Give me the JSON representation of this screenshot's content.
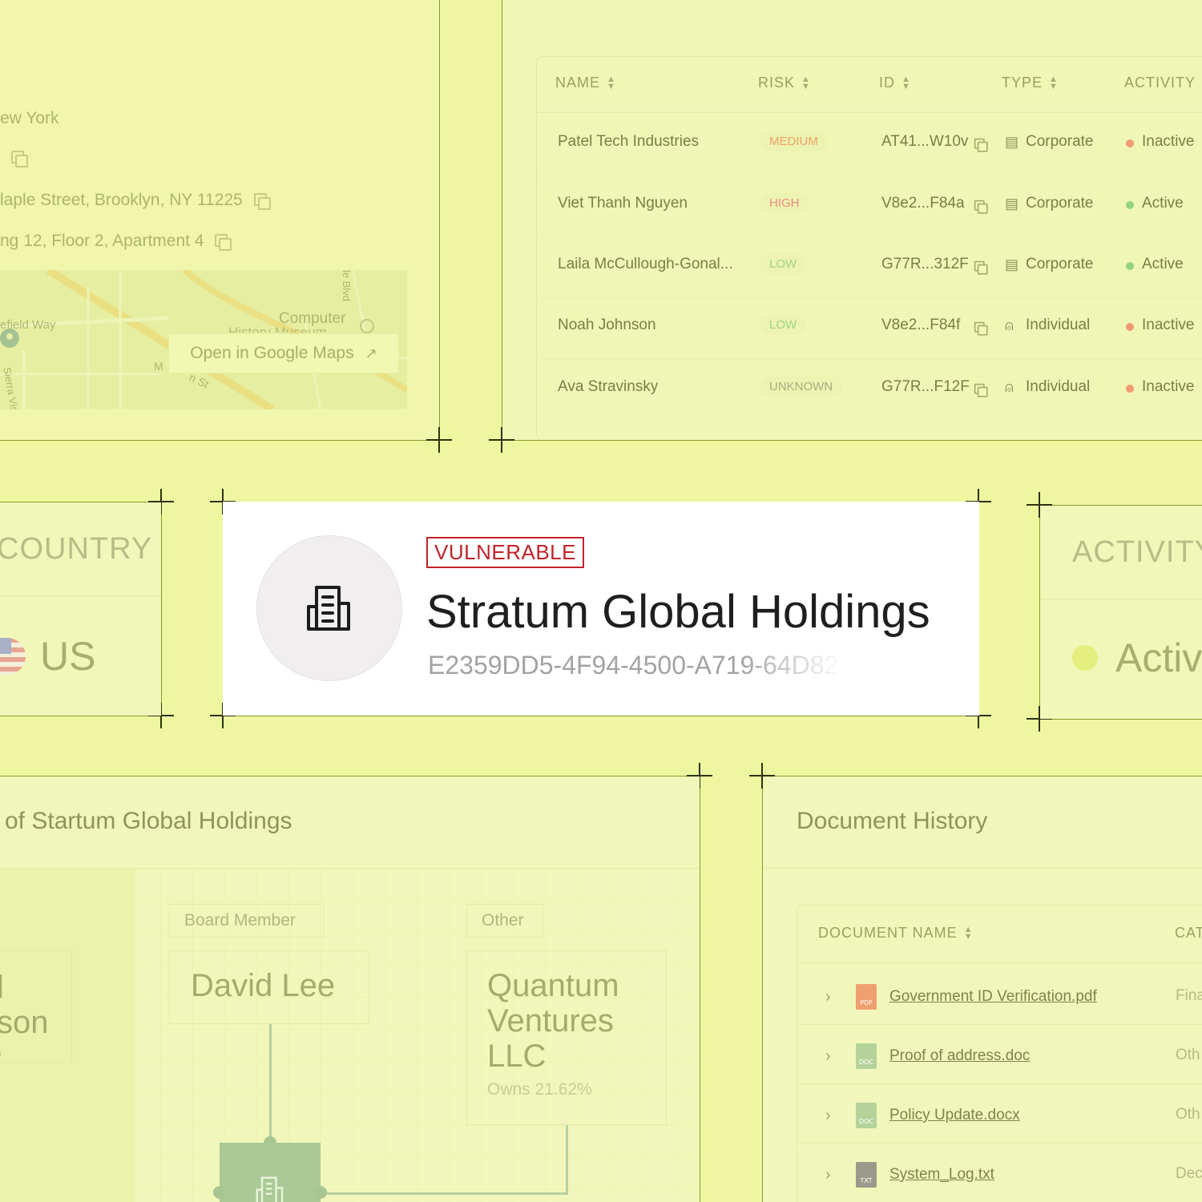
{
  "address": {
    "lines": [
      "ew York",
      "",
      "laple Street, Brooklyn, NY 11225",
      "ng 12, Floor 2, Apartment 4"
    ],
    "map_labels": [
      "Computer",
      "History Museum",
      "efield Way",
      "Sierra Vista Av",
      "le Blvd",
      "M",
      "n St"
    ],
    "map_button": "Open in Google Maps"
  },
  "table": {
    "headers": [
      "NAME",
      "RISK",
      "ID",
      "TYPE",
      "ACTIVITY"
    ],
    "rows": [
      {
        "name": "Patel Tech Industries",
        "risk": "MEDIUM",
        "id": "AT41...W10v",
        "type": "Corporate",
        "activity": "Inactive"
      },
      {
        "name": "Viet Thanh Nguyen",
        "risk": "HIGH",
        "id": "V8e2...F84a",
        "type": "Corporate",
        "activity": "Active"
      },
      {
        "name": "Laila McCullough-Gonal...",
        "risk": "LOW",
        "id": "G77R...312F",
        "type": "Corporate",
        "activity": "Active"
      },
      {
        "name": "Noah Johnson",
        "risk": "LOW",
        "id": "V8e2...F84f",
        "type": "Individual",
        "activity": "Inactive"
      },
      {
        "name": "Ava Stravinsky",
        "risk": "UNKNOWN",
        "id": "G77R...F12F",
        "type": "Individual",
        "activity": "Inactive"
      }
    ]
  },
  "colors": {
    "risk": {
      "MEDIUM": "#f0a06a",
      "HIGH": "#ec8a86",
      "LOW": "#9fd48a",
      "UNKNOWN": "#a8ac82"
    },
    "activity": {
      "Active": "#93d47c",
      "Inactive": "#f09a72"
    },
    "vulnerable": "#c0242a",
    "background": "#eef7a0"
  },
  "hero": {
    "badge": "VULNERABLE",
    "title": "Stratum Global Holdings",
    "id": "E2359DD5-4F94-4500-A719-64D82",
    "icon": "building-icon"
  },
  "country": {
    "label": "COUNTRY",
    "value": "US",
    "flag": "us-flag-icon"
  },
  "activity": {
    "label": "ACTIVITY",
    "value": "Activ"
  },
  "ownership": {
    "title": "of Startum Global Holdings",
    "partial": {
      "name_lines": [
        "l",
        "son"
      ],
      "sub": "o"
    },
    "board": {
      "role": "Board Member",
      "name": "David Lee"
    },
    "other": {
      "role": "Other",
      "name_lines": [
        "Quantum",
        "Ventures",
        "LLC"
      ],
      "sub": "Owns 21.62%"
    }
  },
  "documents": {
    "title": "Document History",
    "headers": [
      "DOCUMENT NAME",
      "CAT"
    ],
    "rows": [
      {
        "name": "Government ID Verification.pdf",
        "ext": "PDF",
        "category": "Fina"
      },
      {
        "name": "Proof of address.doc",
        "ext": "DOC",
        "category": "Oth"
      },
      {
        "name": "Policy Update.docx",
        "ext": "DOC",
        "category": "Oth"
      },
      {
        "name": "System_Log.txt",
        "ext": "TXT",
        "category": "Dec"
      }
    ]
  }
}
